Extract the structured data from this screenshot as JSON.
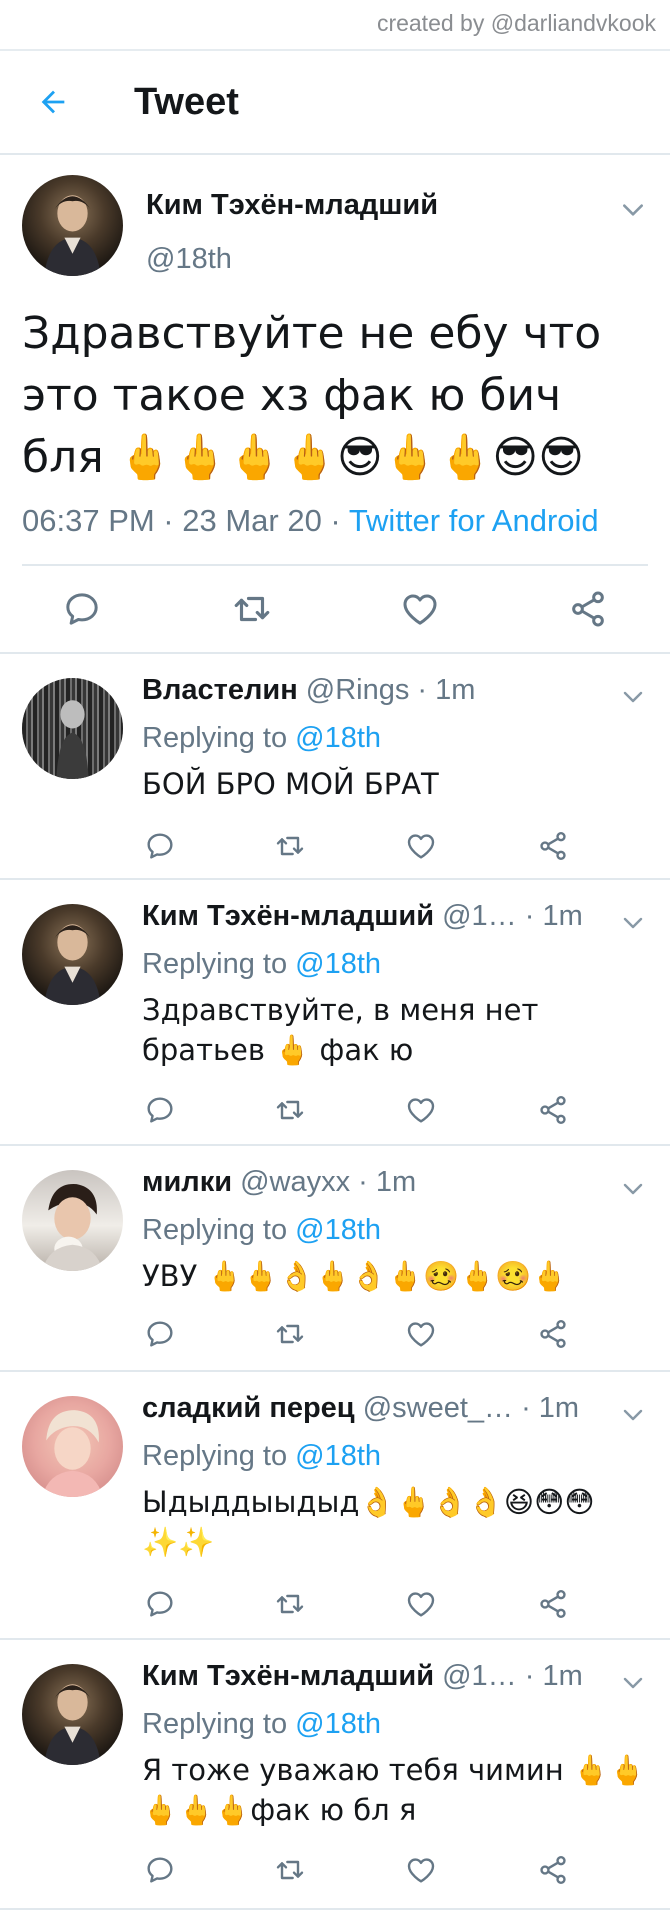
{
  "watermark": "created by @darliandvkook",
  "header": {
    "title": "Tweet"
  },
  "tweet": {
    "name": "Ким Тэхён-младший",
    "handle": "@18th",
    "text": "Здравствуйте не ебу что это такое хз фак ю бич бля 🖕🖕🖕🖕😎🖕🖕😎😎",
    "time_date": "06:37 PM · 23 Mar 20 · ",
    "client": "Twitter for Android"
  },
  "replying_label": "Replying to ",
  "replies": [
    {
      "name": "Властелин",
      "handle": " @Rings · 1m",
      "replying_to": "@18th",
      "text": "БОЙ БРО МОЙ БРАТ"
    },
    {
      "name": "Ким Тэхён-младший",
      "handle": " @1… · 1m",
      "replying_to": "@18th",
      "text": "Здравствуйте, в меня нет братьев 🖕 фак ю"
    },
    {
      "name": "милки",
      "handle": " @wayxx · 1m",
      "replying_to": "@18th",
      "text": "УВУ 🖕🖕👌🖕👌🖕🥴🖕🥴🖕"
    },
    {
      "name": "сладкий перец",
      "handle": " @sweet_… · 1m",
      "replying_to": "@18th",
      "text": "Ыдыддыыдыд👌🖕👌👌😆😳😳✨✨"
    },
    {
      "name": "Ким Тэхён-младший",
      "handle": " @1… · 1m",
      "replying_to": "@18th",
      "text": "Я тоже уважаю тебя чимин 🖕🖕🖕🖕🖕фак ю бл я"
    }
  ],
  "colors": {
    "accent": "#1da1f2",
    "secondary": "#657786",
    "divider": "#e1e8ed"
  },
  "icons": [
    "back-arrow-icon",
    "chevron-down-icon",
    "comment-icon",
    "retweet-icon",
    "heart-icon",
    "share-icon"
  ]
}
